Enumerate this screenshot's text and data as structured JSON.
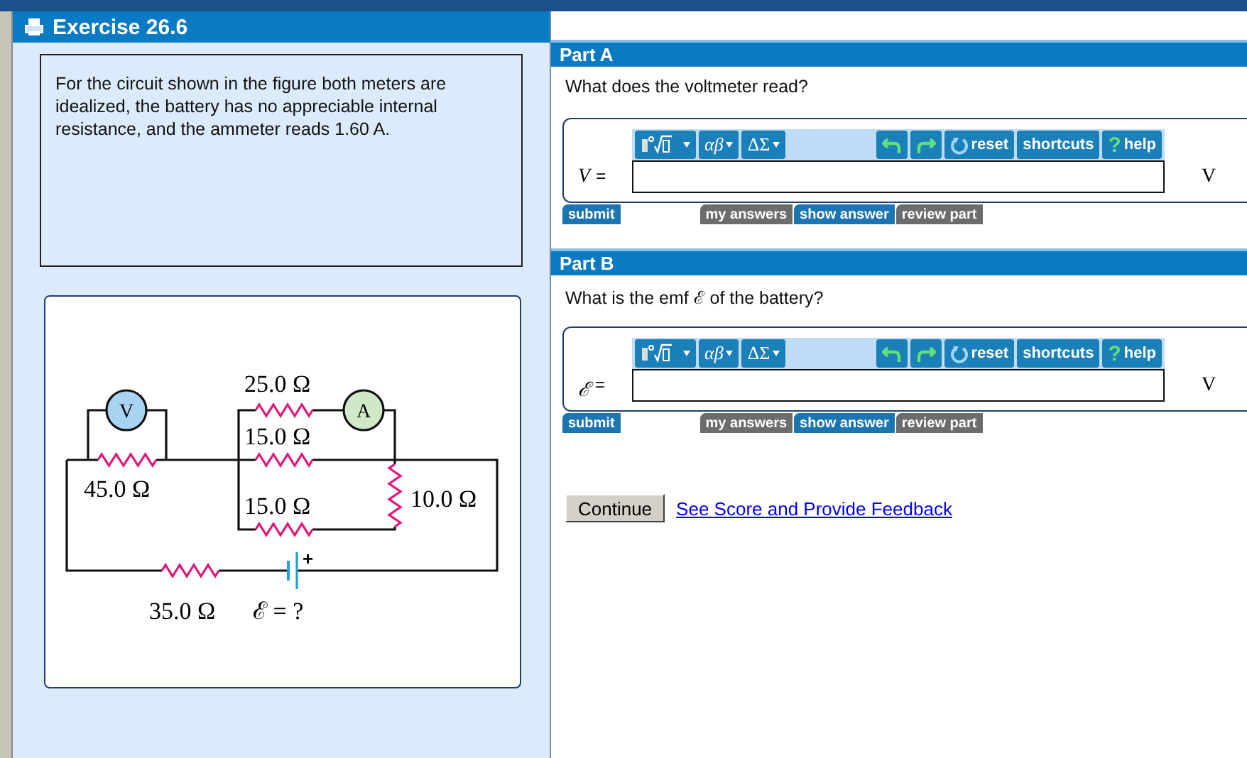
{
  "exercise": {
    "title": "Exercise 26.6",
    "problem": "For the circuit shown in the figure both meters are idealized, the battery has no appreciable internal resistance, and the ammeter reads 1.60 A."
  },
  "figure": {
    "meters": [
      "V",
      "A"
    ],
    "resistor_labels": [
      "45.0 Ω",
      "25.0 Ω",
      "15.0 Ω",
      "15.0 Ω",
      "10.0 Ω",
      "35.0 Ω"
    ],
    "battery_label": "ℰ = ?",
    "battery_sign": "+"
  },
  "parts": [
    {
      "title": "Part A",
      "question": "What does the voltmeter read?",
      "variable": "V",
      "equals": "=",
      "unit": "V",
      "toolbar": {
        "greek": "αβ",
        "operators": "ΔΣ",
        "reset": "reset",
        "shortcuts": "shortcuts",
        "help_mark": "?",
        "help": "help"
      },
      "buttons": [
        "submit",
        "my answers",
        "show answer",
        "review part"
      ]
    },
    {
      "title": "Part B",
      "question": "What is the emf ℰ of the battery?",
      "variable": "ℰ",
      "equals": "=",
      "unit": "V",
      "toolbar": {
        "greek": "αβ",
        "operators": "ΔΣ",
        "reset": "reset",
        "shortcuts": "shortcuts",
        "help_mark": "?",
        "help": "help"
      },
      "buttons": [
        "submit",
        "my answers",
        "show answer",
        "review part"
      ]
    }
  ],
  "footer": {
    "continue": "Continue",
    "link": "See Score and Provide Feedback"
  }
}
